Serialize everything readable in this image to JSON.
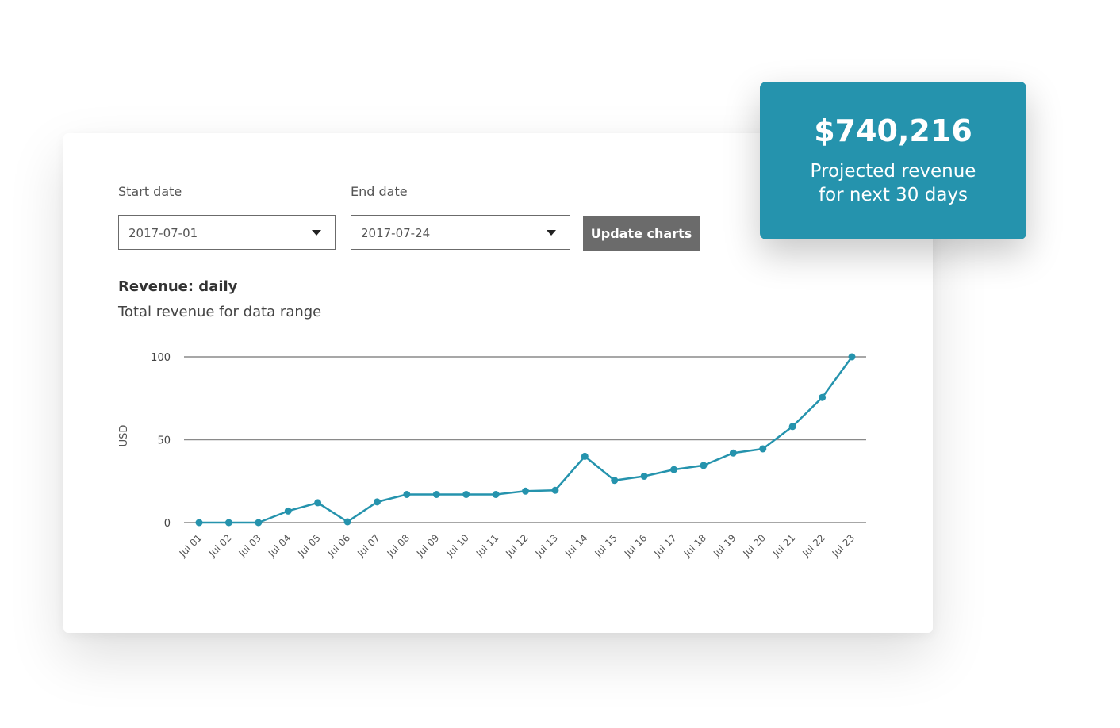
{
  "filters": {
    "start_label": "Start date",
    "start_value": "2017-07-01",
    "end_label": "End date",
    "end_value": "2017-07-24",
    "update_button": "Update charts"
  },
  "chart_header": {
    "title": "Revenue: daily",
    "subtitle": "Total revenue for data range"
  },
  "kpi": {
    "amount": "$740,216",
    "label_line1": "Projected revenue",
    "label_line2": "for next 30 days"
  },
  "colors": {
    "accent": "#2593ad",
    "button": "#6b6b6b",
    "grid": "#8a8a8a"
  },
  "chart_data": {
    "type": "line",
    "title": "Revenue: daily",
    "subtitle": "Total revenue for data range",
    "xlabel": "",
    "ylabel": "USD",
    "ylim": [
      0,
      100
    ],
    "yticks": [
      0,
      50,
      100
    ],
    "grid": true,
    "categories": [
      "Jul 01",
      "Jul 02",
      "Jul 03",
      "Jul 04",
      "Jul 05",
      "Jul 06",
      "Jul 07",
      "Jul 08",
      "Jul 09",
      "Jul 10",
      "Jul 11",
      "Jul 12",
      "Jul 13",
      "Jul 14",
      "Jul 15",
      "Jul 16",
      "Jul 17",
      "Jul 18",
      "Jul 19",
      "Jul 20",
      "Jul 21",
      "Jul 22",
      "Jul 23"
    ],
    "series": [
      {
        "values": [
          0,
          0,
          0,
          7,
          12,
          0.5,
          12.5,
          17,
          17,
          17,
          17,
          19,
          19.5,
          40,
          25.5,
          28,
          32,
          34.5,
          42,
          44.5,
          58,
          75.5,
          100
        ]
      }
    ]
  }
}
